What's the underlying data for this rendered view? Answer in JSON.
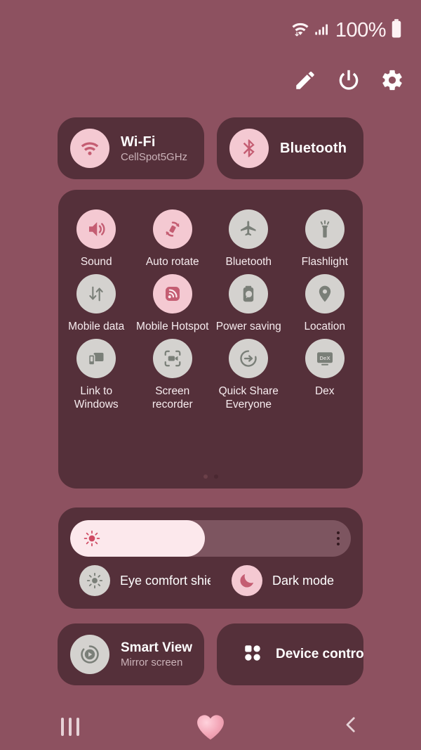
{
  "status_bar": {
    "wifi_icon": "wifi-data-icon",
    "signal_icon": "cellular-signal-icon",
    "battery_text": "100%",
    "battery_icon": "battery-full-icon"
  },
  "header": {
    "actions": [
      {
        "name": "edit-button",
        "icon": "pencil-icon"
      },
      {
        "name": "power-button",
        "icon": "power-icon"
      },
      {
        "name": "settings-button",
        "icon": "gear-icon"
      }
    ]
  },
  "connection_cards": [
    {
      "name": "wifi-card",
      "icon": "wifi-icon",
      "title": "Wi-Fi",
      "subtitle": "CellSpot5GHz",
      "state": "on"
    },
    {
      "name": "bluetooth-card",
      "icon": "bluetooth-icon",
      "title": "Bluetooth",
      "subtitle": "",
      "state": "on"
    }
  ],
  "quick_toggles": {
    "rows": [
      [
        {
          "name": "toggle-sound",
          "label": "Sound",
          "icon": "sound-icon",
          "state": "on"
        },
        {
          "name": "toggle-auto-rotate",
          "label": "Auto rotate",
          "icon": "auto-rotate-icon",
          "state": "on"
        },
        {
          "name": "toggle-bluetooth",
          "label": "Bluetooth",
          "icon": "airplane-icon",
          "state": "off"
        },
        {
          "name": "toggle-flashlight",
          "label": "Flashlight",
          "icon": "flashlight-icon",
          "state": "off"
        }
      ],
      [
        {
          "name": "toggle-mobile-data",
          "label": "Mobile data",
          "icon": "mobile-data-icon",
          "state": "off"
        },
        {
          "name": "toggle-mobile-hotspot",
          "label": "Mobile Hotspot",
          "icon": "hotspot-icon",
          "state": "on"
        },
        {
          "name": "toggle-power-saving",
          "label": "Power saving",
          "icon": "power-saving-icon",
          "state": "off"
        },
        {
          "name": "toggle-location",
          "label": "Location",
          "icon": "location-pin-icon",
          "state": "off"
        }
      ],
      [
        {
          "name": "toggle-link-to-windows",
          "label": "Link to Windows",
          "icon": "link-to-windows-icon",
          "state": "off"
        },
        {
          "name": "toggle-screen-recorder",
          "label": "Screen recorder",
          "icon": "screen-recorder-icon",
          "state": "off"
        },
        {
          "name": "toggle-quick-share",
          "label": "Quick Share Everyone",
          "icon": "quick-share-icon",
          "state": "off"
        },
        {
          "name": "toggle-dex",
          "label": "Dex",
          "icon": "dex-icon",
          "state": "off"
        }
      ]
    ],
    "page_indicator": {
      "total": 2,
      "active": 1
    }
  },
  "brightness": {
    "name": "brightness-slider",
    "icon": "brightness-sun-icon",
    "value_percent": 48,
    "more_options_icon": "more-options-icon"
  },
  "display_modes": [
    {
      "name": "eye-comfort-shield-toggle",
      "label": "Eye comfort shield",
      "icon": "eye-comfort-icon",
      "state": "off"
    },
    {
      "name": "dark-mode-toggle",
      "label": "Dark mode",
      "icon": "moon-icon",
      "state": "on"
    }
  ],
  "bottom_cards": [
    {
      "name": "smart-view-card",
      "icon": "smart-view-icon",
      "title": "Smart View",
      "subtitle": "Mirror screen"
    },
    {
      "name": "device-control-card",
      "icon": "device-control-icon",
      "title": "Device control",
      "subtitle": ""
    }
  ],
  "nav_bar": [
    {
      "name": "nav-recents-button",
      "icon": "recents-icon"
    },
    {
      "name": "nav-home-button",
      "icon": "heart-home-icon"
    },
    {
      "name": "nav-back-button",
      "icon": "back-chevron-icon"
    }
  ],
  "colors": {
    "background": "#8d5160",
    "panel": "#55303a",
    "accent_pink": "#f4c9d2",
    "accent_pink_icon": "#c45d72",
    "inactive_grey": "#d4d2cf",
    "inactive_grey_icon": "#7a7f78",
    "text_primary": "#ffffff",
    "text_secondary": "#cbb3b9"
  }
}
